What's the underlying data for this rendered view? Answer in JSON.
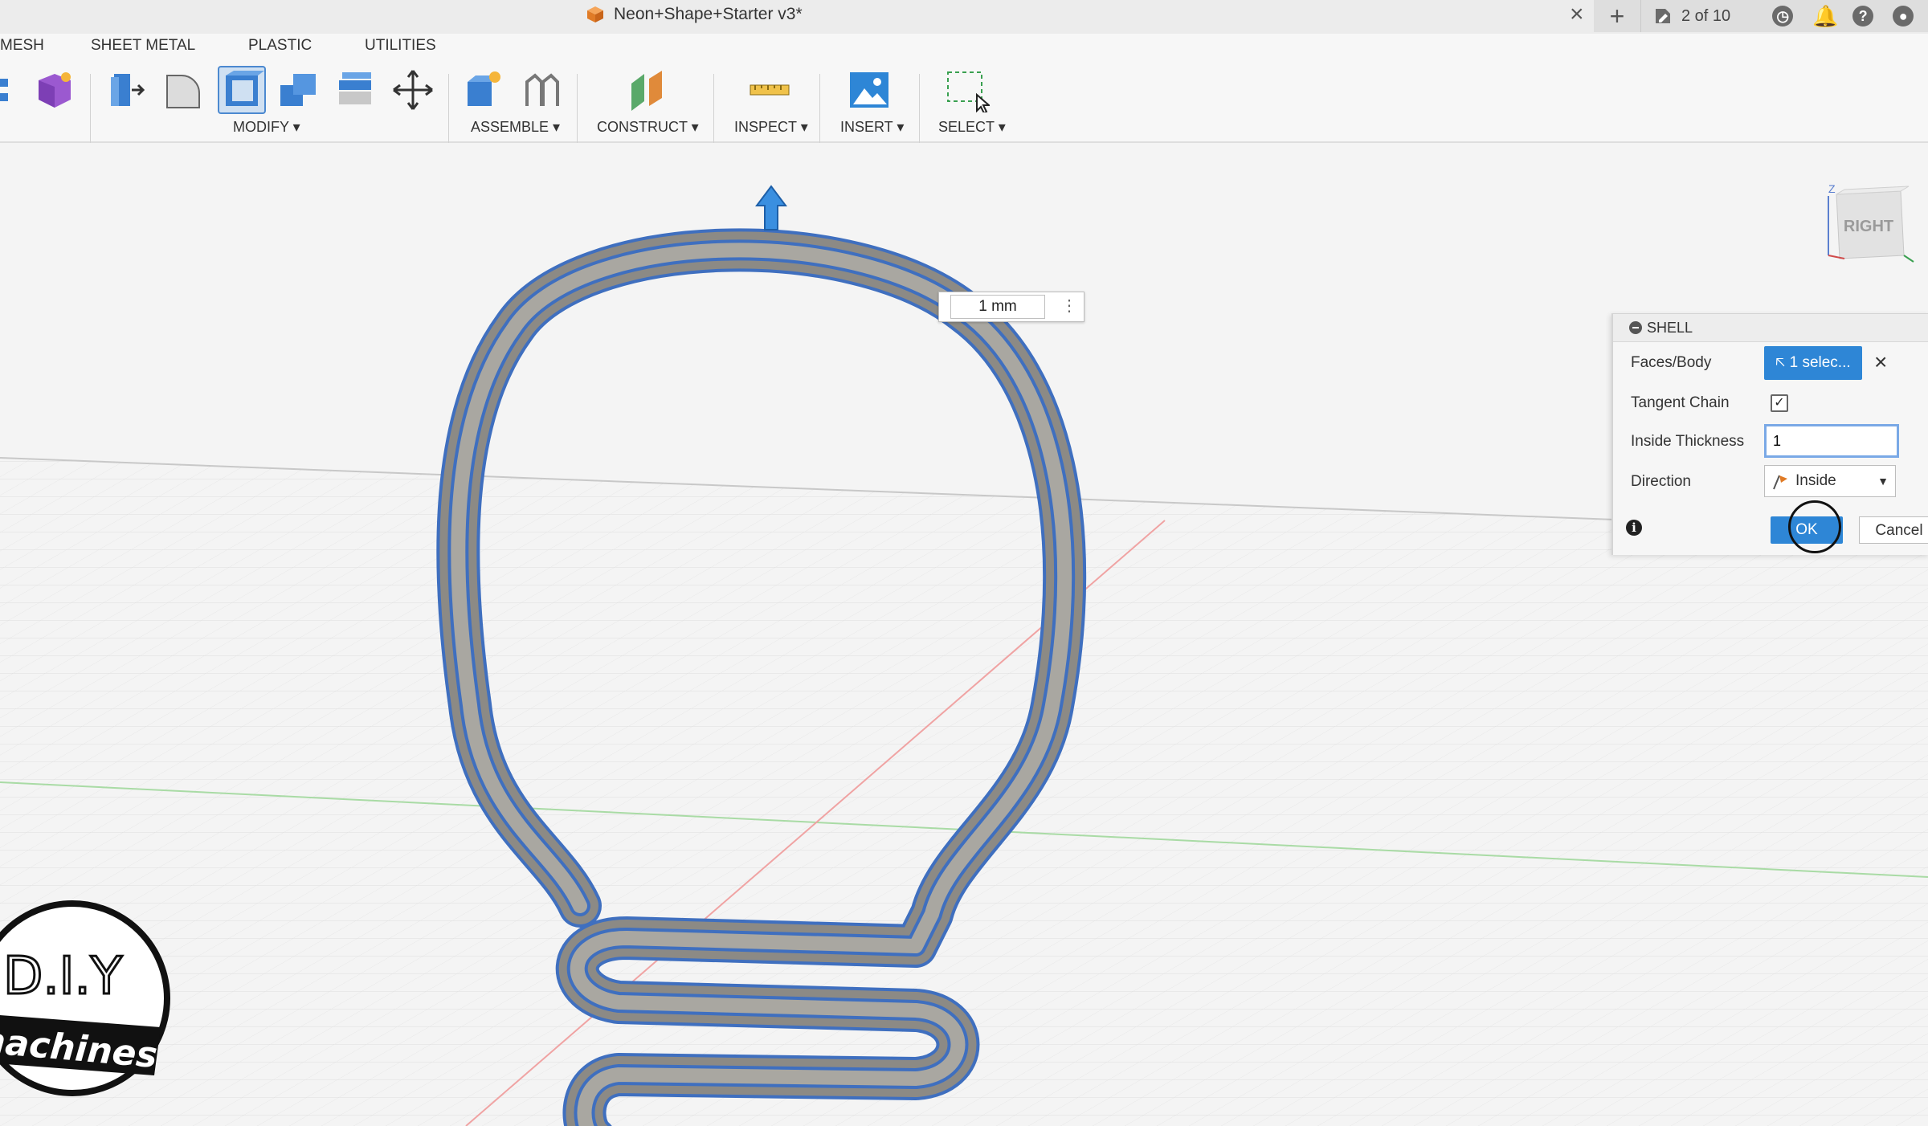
{
  "window": {
    "document_title": "Neon+Shape+Starter v3*",
    "jobs_status": "2 of 10"
  },
  "toolbar": {
    "tabs": [
      "MESH",
      "SHEET METAL",
      "PLASTIC",
      "UTILITIES"
    ],
    "groups": {
      "modify": "MODIFY ▾",
      "assemble": "ASSEMBLE ▾",
      "construct": "CONSTRUCT ▾",
      "inspect": "INSPECT ▾",
      "insert": "INSERT ▾",
      "select": "SELECT ▾"
    }
  },
  "viewport": {
    "dimension_value": "1 mm",
    "view_cube_label": "RIGHT",
    "logo_text_top": "D.I.Y",
    "logo_text_bottom": "machines"
  },
  "shell_dialog": {
    "title": "SHELL",
    "faces_body_label": "Faces/Body",
    "faces_body_value": "1 selec...",
    "tangent_chain_label": "Tangent Chain",
    "tangent_chain_checked": "✓",
    "inside_thickness_label": "Inside Thickness",
    "inside_thickness_value": "1",
    "direction_label": "Direction",
    "direction_value": "Inside",
    "ok_label": "OK",
    "cancel_label": "Cancel"
  },
  "colors": {
    "accent": "#2e86d6",
    "edge_highlight": "#3f6fbf",
    "body": "#8c8a85"
  }
}
